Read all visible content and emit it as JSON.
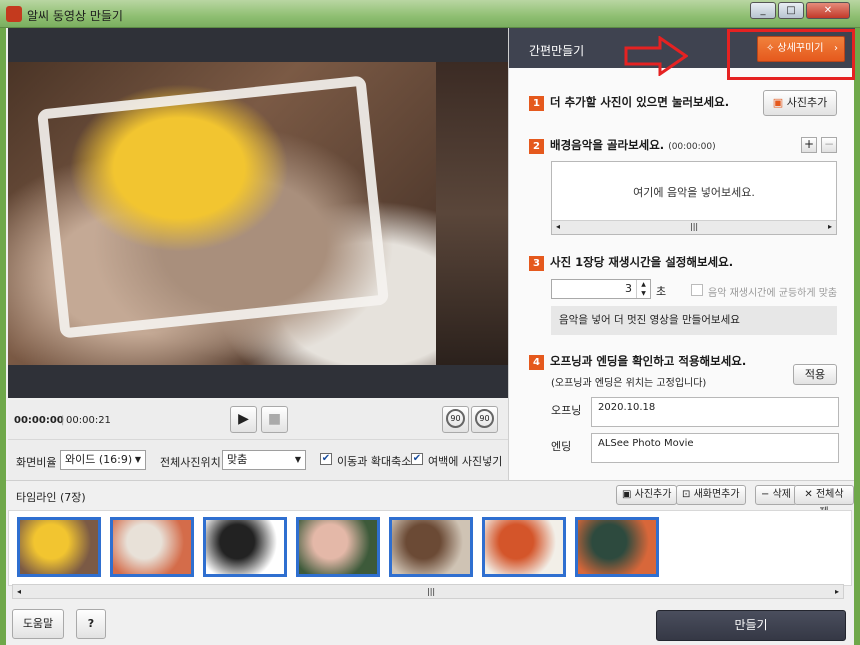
{
  "window": {
    "title": "알씨 동영상 만들기",
    "controls": [
      "_",
      "□",
      "✕"
    ]
  },
  "preview": {
    "current_time": "00:00:00",
    "separator": "|",
    "total_time": "00:00:21",
    "play_glyph": "▶",
    "stop_glyph": "■",
    "rotate_left_label": "90",
    "rotate_right_label": "90"
  },
  "options": {
    "aspect_label": "화면비율",
    "aspect_value": "와이드 (16:9)",
    "position_label": "전체사진위치",
    "position_value": "맞춤",
    "pan_zoom_label": "이동과 확대축소",
    "pan_zoom_checked": true,
    "fill_margin_label": "여백에 사진넣기",
    "fill_margin_checked": true
  },
  "panel": {
    "title": "간편만들기",
    "detail_button": "상세꾸미기",
    "step1": {
      "num": "1",
      "text": "더 추가할 사진이 있으면 눌러보세요.",
      "button": "사진추가"
    },
    "step2": {
      "num": "2",
      "text": "배경음악을 골라보세요.",
      "duration": "(00:00:00)",
      "add": "+",
      "remove": "−",
      "placeholder": "여기에 음악을 넣어보세요."
    },
    "step3": {
      "num": "3",
      "text": "사진 1장당 재생시간을 설정해보세요.",
      "seconds_value": "3",
      "seconds_unit": "초",
      "fit_music_label": "음악 재생시간에 균등하게 맞춤",
      "hint": "음악을 넣어 더 멋진 영상을 만들어보세요"
    },
    "step4": {
      "num": "4",
      "text": "오프닝과 엔딩을 확인하고 적용해보세요.",
      "note": "(오프닝과 엔딩은 위치는 고정입니다)",
      "apply_button": "적용",
      "opening_label": "오프닝",
      "opening_value": "2020.10.18",
      "ending_label": "엔딩",
      "ending_value": "ALSee Photo Movie"
    }
  },
  "timeline": {
    "title": "타임라인 (7장)",
    "add_photo": "사진추가",
    "add_new_screen": "새화면추가",
    "delete": "삭제",
    "delete_all": "전체삭제",
    "thumbnails": [
      {
        "colors": [
          "#f2c530",
          "#7b5a45"
        ]
      },
      {
        "colors": [
          "#e8e1d8",
          "#d46c4a"
        ]
      },
      {
        "colors": [
          "#222222",
          "#ffffff"
        ]
      },
      {
        "colors": [
          "#e4b8a8",
          "#3d5a3a"
        ]
      },
      {
        "colors": [
          "#6b4a35",
          "#cfc3b4"
        ]
      },
      {
        "colors": [
          "#d4552a",
          "#f2efe8"
        ]
      },
      {
        "colors": [
          "#2d4a3e",
          "#d8673a"
        ]
      }
    ]
  },
  "bottom": {
    "help_button": "도움말",
    "question_button": "?",
    "make_button": "만들기"
  }
}
